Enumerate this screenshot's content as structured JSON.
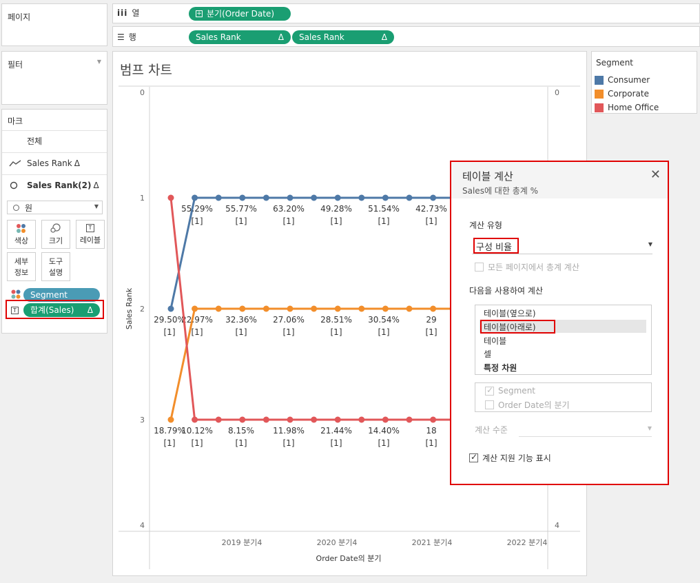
{
  "shelves": {
    "pages_label": "페이지",
    "filters_label": "필터",
    "columns_label": "열",
    "rows_label": "행",
    "columns_pill": "분기(Order Date)",
    "rows_pills": [
      {
        "label": "Sales Rank",
        "delta": "Δ"
      },
      {
        "label": "Sales Rank",
        "delta": "Δ"
      }
    ]
  },
  "marks": {
    "title": "마크",
    "all": "전체",
    "line_item": "Sales Rank",
    "line_delta": "Δ",
    "circle_item": "Sales Rank(2)",
    "circle_delta": "Δ",
    "mark_type": "원",
    "buttons": [
      "색상",
      "크기",
      "레이블"
    ],
    "buttons2": [
      [
        "세부",
        "정보"
      ],
      [
        "도구",
        "설명"
      ]
    ],
    "segment_pill": "Segment",
    "label_pill": "합계(Sales)",
    "label_delta": "Δ"
  },
  "legend": {
    "title": "Segment",
    "items": [
      {
        "name": "Consumer",
        "color": "#4e79a7"
      },
      {
        "name": "Corporate",
        "color": "#f28e2b"
      },
      {
        "name": "Home Office",
        "color": "#e15759"
      }
    ]
  },
  "chart_title": "범프 차트",
  "chart_data": {
    "type": "line",
    "ylabel": "Sales Rank",
    "xlabel": "Order Date의 분기",
    "ylim": [
      0,
      4
    ],
    "y_ticks": [
      "0",
      "1",
      "2",
      "3",
      "4"
    ],
    "x_tick_labels": [
      "2019 분기4",
      "2020 분기4",
      "2021 분기4",
      "2022 분기4"
    ],
    "series": [
      {
        "name": "Consumer",
        "color": "#4e79a7",
        "values": [
          2,
          1,
          1,
          1,
          1,
          1,
          1,
          1,
          1,
          1,
          1,
          1,
          1,
          1,
          1,
          1
        ],
        "labels": [
          "29.50%",
          "55.29%",
          "55.77%",
          "63.20%",
          "49.28%",
          "51.54%",
          "42.73%"
        ]
      },
      {
        "name": "Corporate",
        "color": "#f28e2b",
        "values": [
          3,
          2,
          2,
          2,
          2,
          2,
          2,
          2,
          2,
          2,
          2,
          2,
          2,
          2,
          2,
          2
        ],
        "labels": [
          "18.79%",
          "22.97%",
          "32.36%",
          "27.06%",
          "28.51%",
          "30.54%",
          "29"
        ]
      },
      {
        "name": "Home Office",
        "color": "#e15759",
        "values": [
          1,
          3,
          3,
          3,
          3,
          3,
          3,
          3,
          3,
          3,
          3,
          3,
          3,
          3,
          3,
          3
        ],
        "labels": [
          "",
          "10.12%",
          "8.15%",
          "11.98%",
          "21.44%",
          "14.40%",
          "18"
        ]
      }
    ],
    "label_suffix": "[1]"
  },
  "dialog": {
    "title": "테이블 계산",
    "subtitle": "Sales에 대한 총계 %",
    "calc_type_label": "계산 유형",
    "calc_type_value": "구성 비율",
    "all_pages_label": "모든 페이지에서 총계 계산",
    "compute_using_label": "다음을 사용하여 계산",
    "compute_options": [
      "테이블(옆으로)",
      "테이블(아래로)",
      "테이블",
      "셀",
      "특정 차원"
    ],
    "dimensions": [
      "Segment",
      "Order Date의 분기"
    ],
    "level_label": "계산 수준",
    "show_assist_label": "계산 지원 기능 표시"
  }
}
